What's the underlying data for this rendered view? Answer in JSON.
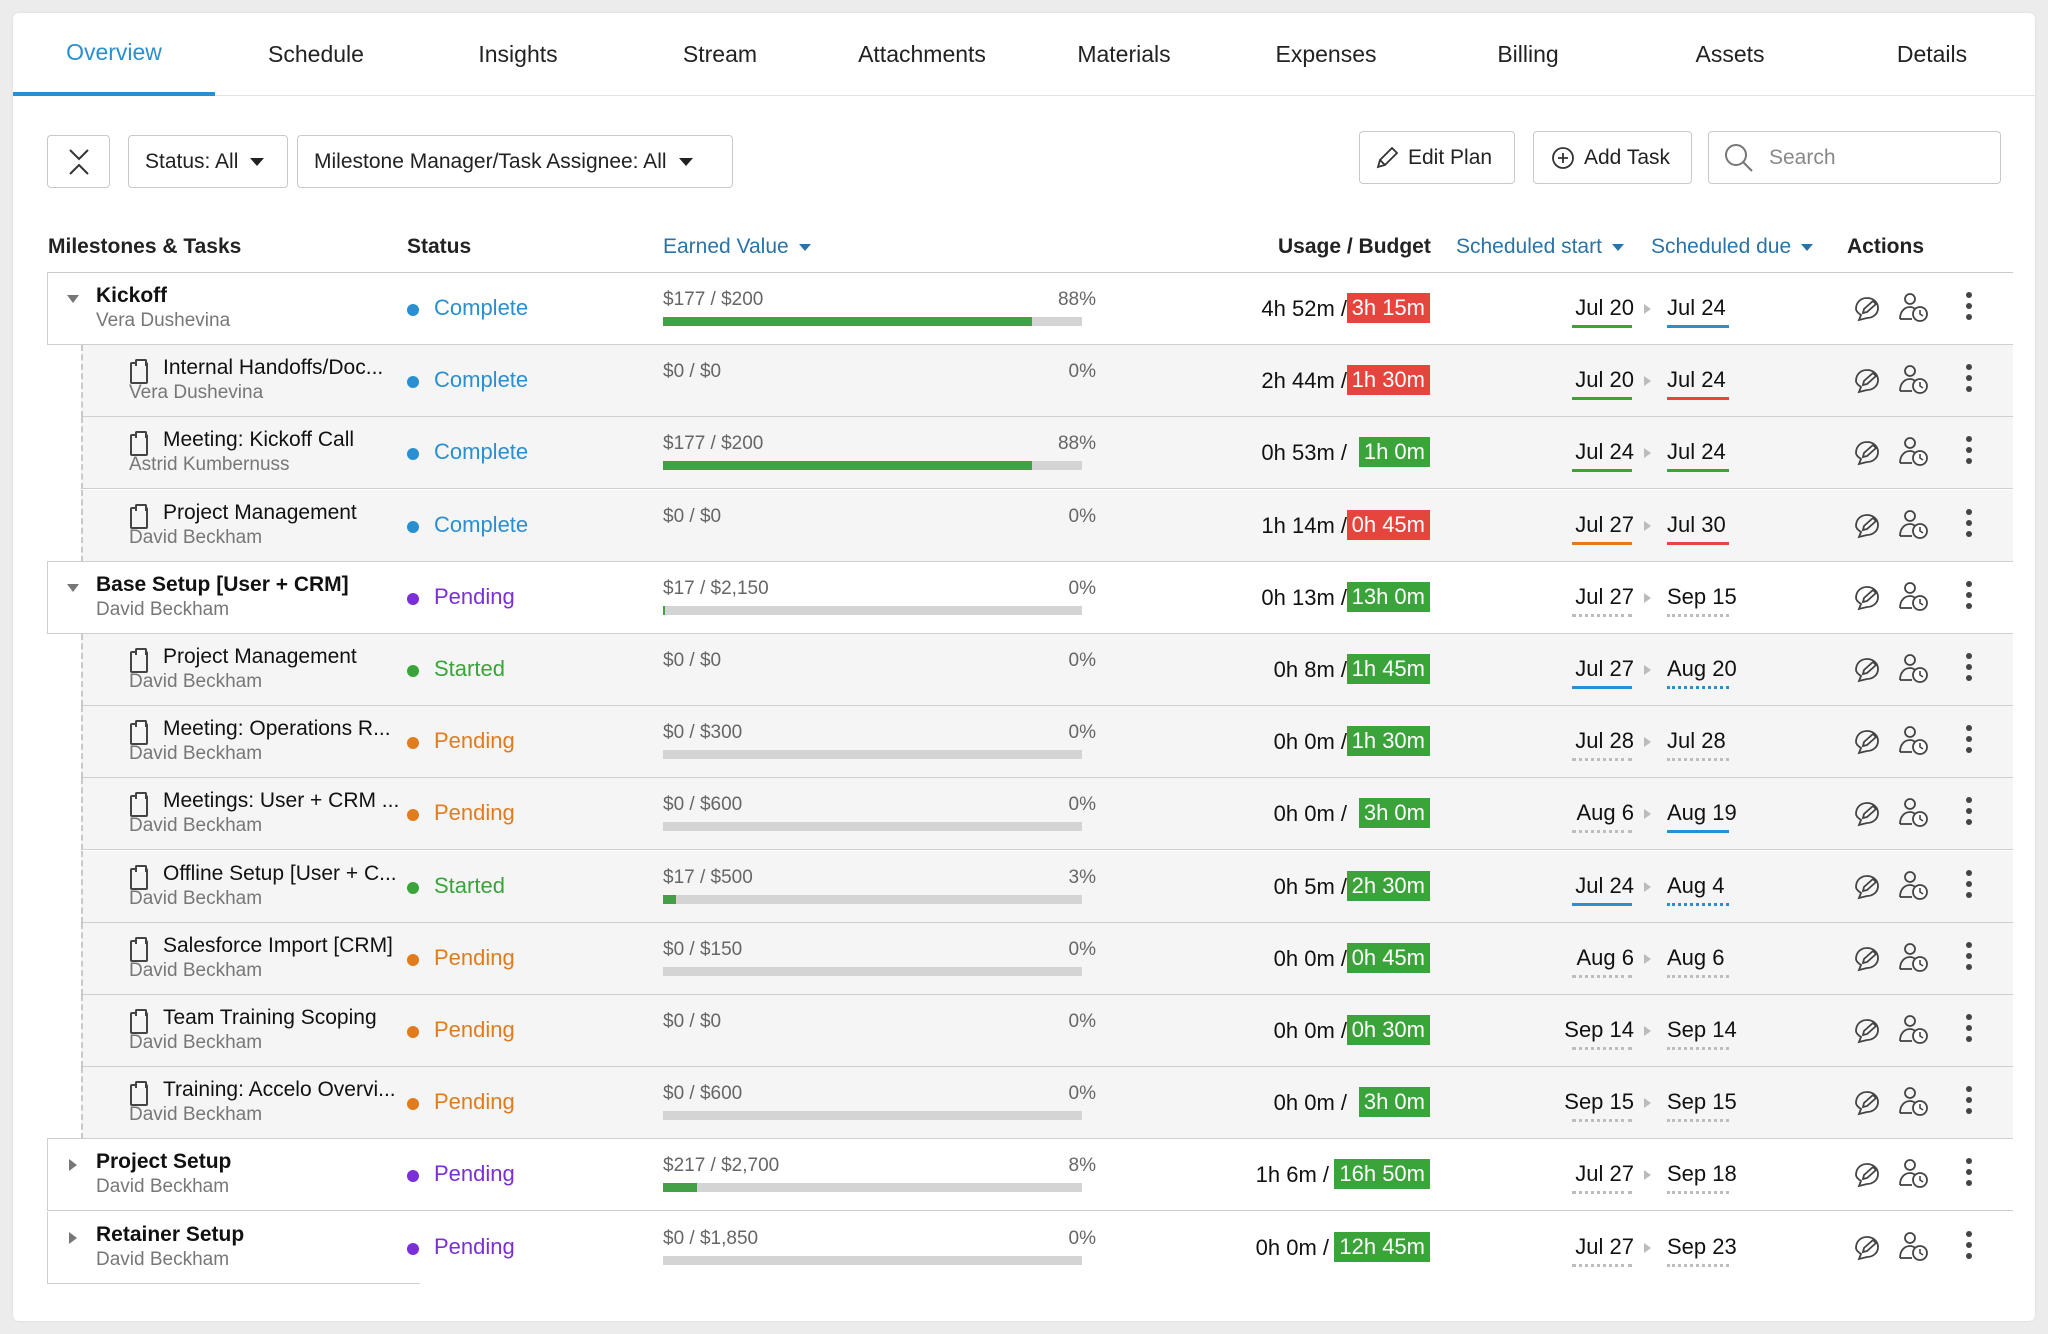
{
  "tabs": [
    {
      "label": "Overview",
      "active": true
    },
    {
      "label": "Schedule",
      "active": false
    },
    {
      "label": "Insights",
      "active": false
    },
    {
      "label": "Stream",
      "active": false
    },
    {
      "label": "Attachments",
      "active": false
    },
    {
      "label": "Materials",
      "active": false
    },
    {
      "label": "Expenses",
      "active": false
    },
    {
      "label": "Billing",
      "active": false
    },
    {
      "label": "Assets",
      "active": false
    },
    {
      "label": "Details",
      "active": false
    }
  ],
  "toolbar": {
    "status_filter": "Status: All",
    "assignee_filter": "Milestone Manager/Task Assignee: All",
    "edit_plan": "Edit Plan",
    "add_task": "Add Task",
    "search_placeholder": "Search"
  },
  "columns": {
    "milestones": "Milestones & Tasks",
    "status": "Status",
    "earned_value": "Earned Value",
    "usage_budget": "Usage / Budget",
    "scheduled_start": "Scheduled start",
    "scheduled_due": "Scheduled due",
    "actions": "Actions"
  },
  "colors": {
    "accent": "#2a8fd0",
    "complete": "#2a8fd0",
    "pending_milestone": "#7b2fd6",
    "pending_task": "#e07b20",
    "started": "#3aa33a",
    "over_budget": "#e5453d",
    "under_budget": "#3aa33a"
  },
  "rows": [
    {
      "type": "milestone",
      "expanded": true,
      "name": "Kickoff",
      "person": "Vera Dushevina",
      "status": "Complete",
      "status_key": "complete",
      "ev": "$177 / $200",
      "pct": "88%",
      "progress": 0.88,
      "usage": "4h 52m /",
      "budget": "3h 15m",
      "over": true,
      "start": "Jul 20",
      "start_line": "green",
      "due": "Jul 24",
      "due_line": "blue"
    },
    {
      "type": "task",
      "name": "Internal Handoffs/Doc...",
      "person": "Vera Dushevina",
      "status": "Complete",
      "status_key": "complete",
      "ev": "$0 / $0",
      "pct": "0%",
      "progress": null,
      "usage": "2h 44m /",
      "budget": "1h 30m",
      "over": true,
      "start": "Jul 20",
      "start_line": "green",
      "due": "Jul 24",
      "due_line": "red"
    },
    {
      "type": "task",
      "name": "Meeting: Kickoff Call",
      "person": "Astrid Kumbernuss",
      "status": "Complete",
      "status_key": "complete",
      "ev": "$177 / $200",
      "pct": "88%",
      "progress": 0.88,
      "usage": "0h 53m /",
      "budget": "1h 0m",
      "over": false,
      "start": "Jul 24",
      "start_line": "green",
      "due": "Jul 24",
      "due_line": "green"
    },
    {
      "type": "task",
      "name": "Project Management",
      "person": "David Beckham",
      "status": "Complete",
      "status_key": "complete",
      "ev": "$0 / $0",
      "pct": "0%",
      "progress": null,
      "usage": "1h 14m /",
      "budget": "0h 45m",
      "over": true,
      "start": "Jul 27",
      "start_line": "orange",
      "due": "Jul 30",
      "due_line": "red"
    },
    {
      "type": "milestone",
      "expanded": true,
      "name": "Base Setup [User + CRM]",
      "person": "David Beckham",
      "status": "Pending",
      "status_key": "pending_milestone",
      "ev": "$17 / $2,150",
      "pct": "0%",
      "progress": 0.005,
      "usage": "0h 13m /",
      "budget": "13h 0m",
      "over": false,
      "start": "Jul 27",
      "start_line": "dotted",
      "due": "Sep 15",
      "due_line": "dotted"
    },
    {
      "type": "task",
      "name": "Project Management",
      "person": "David Beckham",
      "status": "Started",
      "status_key": "started",
      "ev": "$0 / $0",
      "pct": "0%",
      "progress": null,
      "usage": "0h 8m /",
      "budget": "1h 45m",
      "over": false,
      "start": "Jul 27",
      "start_line": "blue",
      "due": "Aug 20",
      "due_line": "dotted-blue"
    },
    {
      "type": "task",
      "name": "Meeting: Operations R...",
      "person": "David Beckham",
      "status": "Pending",
      "status_key": "pending_task",
      "ev": "$0 / $300",
      "pct": "0%",
      "progress": 0,
      "usage": "0h 0m /",
      "budget": "1h 30m",
      "over": false,
      "start": "Jul 28",
      "start_line": "dotted",
      "due": "Jul 28",
      "due_line": "dotted"
    },
    {
      "type": "task",
      "name": "Meetings: User + CRM ...",
      "person": "David Beckham",
      "status": "Pending",
      "status_key": "pending_task",
      "ev": "$0 / $600",
      "pct": "0%",
      "progress": 0,
      "usage": "0h 0m /",
      "budget": "3h 0m",
      "over": false,
      "start": "Aug 6",
      "start_line": "dotted",
      "due": "Aug 19",
      "due_line": "blue"
    },
    {
      "type": "task",
      "name": "Offline Setup [User + C...",
      "person": "David Beckham",
      "status": "Started",
      "status_key": "started",
      "ev": "$17 / $500",
      "pct": "3%",
      "progress": 0.03,
      "usage": "0h 5m /",
      "budget": "2h 30m",
      "over": false,
      "start": "Jul 24",
      "start_line": "blue",
      "due": "Aug 4",
      "due_line": "dotted-blue"
    },
    {
      "type": "task",
      "name": "Salesforce Import [CRM]",
      "person": "David Beckham",
      "status": "Pending",
      "status_key": "pending_task",
      "ev": "$0 / $150",
      "pct": "0%",
      "progress": 0,
      "usage": "0h 0m /",
      "budget": "0h 45m",
      "over": false,
      "start": "Aug 6",
      "start_line": "dotted",
      "due": "Aug 6",
      "due_line": "dotted"
    },
    {
      "type": "task",
      "name": "Team Training Scoping",
      "person": "David Beckham",
      "status": "Pending",
      "status_key": "pending_task",
      "ev": "$0 / $0",
      "pct": "0%",
      "progress": null,
      "usage": "0h 0m /",
      "budget": "0h 30m",
      "over": false,
      "start": "Sep 14",
      "start_line": "dotted",
      "due": "Sep 14",
      "due_line": "dotted"
    },
    {
      "type": "task",
      "name": "Training: Accelo Overvi...",
      "person": "David Beckham",
      "status": "Pending",
      "status_key": "pending_task",
      "ev": "$0 / $600",
      "pct": "0%",
      "progress": 0,
      "usage": "0h 0m /",
      "budget": "3h 0m",
      "over": false,
      "start": "Sep 15",
      "start_line": "dotted",
      "due": "Sep 15",
      "due_line": "dotted"
    },
    {
      "type": "milestone",
      "expanded": false,
      "name": "Project Setup",
      "person": "David Beckham",
      "status": "Pending",
      "status_key": "pending_milestone",
      "ev": "$217 / $2,700",
      "pct": "8%",
      "progress": 0.08,
      "usage": "1h 6m /",
      "budget": "16h 50m",
      "over": false,
      "start": "Jul 27",
      "start_line": "dotted",
      "due": "Sep 18",
      "due_line": "dotted"
    },
    {
      "type": "milestone",
      "expanded": false,
      "name": "Retainer Setup",
      "person": "David Beckham",
      "status": "Pending",
      "status_key": "pending_milestone",
      "ev": "$0 / $1,850",
      "pct": "0%",
      "progress": 0,
      "usage": "0h 0m /",
      "budget": "12h 45m",
      "over": false,
      "start": "Jul 27",
      "start_line": "dotted",
      "due": "Sep 23",
      "due_line": "dotted"
    }
  ],
  "icons": {
    "collapse": "collapse-all-icon",
    "edit": "pencil-icon",
    "add": "plus-circle-icon",
    "search": "search-icon",
    "comment": "comment-edit-icon",
    "assign": "user-clock-icon",
    "more": "kebab-menu-icon"
  }
}
